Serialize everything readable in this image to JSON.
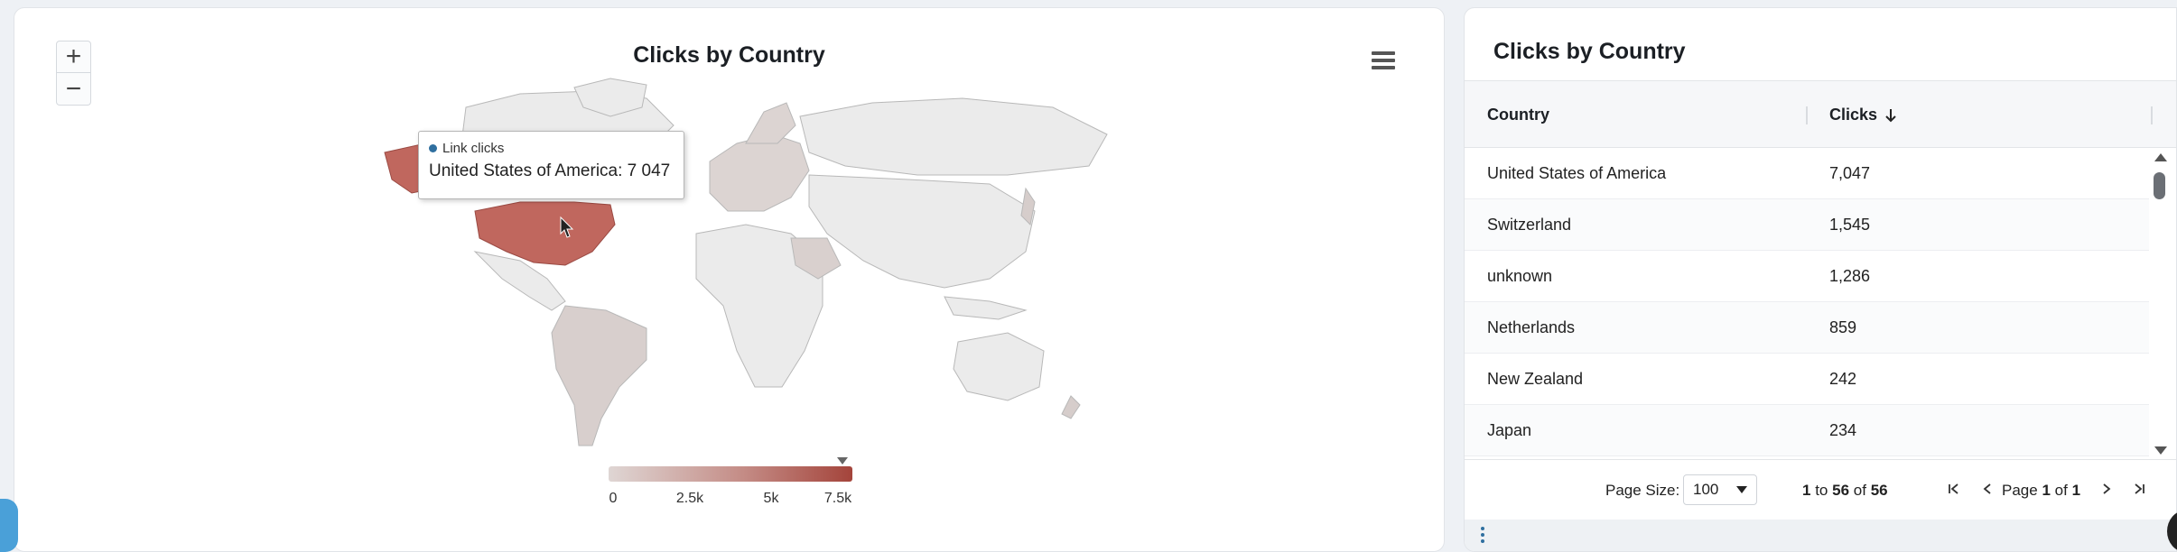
{
  "map_panel": {
    "title": "Clicks by Country",
    "zoom_in_label": "+",
    "zoom_out_label": "−",
    "menu_icon": "hamburger-menu-icon",
    "tooltip": {
      "series_name": "Link clicks",
      "text": "United States of America: 7 047"
    },
    "legend": {
      "ticks": [
        "0",
        "2.5k",
        "5k",
        "7.5k"
      ],
      "colors": [
        "#dfd6d4",
        "#a4443b"
      ]
    },
    "highlight_color": "#c0675e"
  },
  "table_panel": {
    "title": "Clicks by Country",
    "columns": [
      "Country",
      "Clicks"
    ],
    "sort_icon": "arrow-down-icon",
    "rows": [
      {
        "country": "United States of America",
        "clicks": "7,047"
      },
      {
        "country": "Switzerland",
        "clicks": "1,545"
      },
      {
        "country": "unknown",
        "clicks": "1,286"
      },
      {
        "country": "Netherlands",
        "clicks": "859"
      },
      {
        "country": "New Zealand",
        "clicks": "242"
      },
      {
        "country": "Japan",
        "clicks": "234"
      }
    ],
    "footer": {
      "page_size_label": "Page Size:",
      "page_size_value": "100",
      "range_from": "1",
      "range_to_word": "to",
      "range_to": "56",
      "range_of_word": "of",
      "range_total": "56",
      "page_word": "Page",
      "page_current": "1",
      "page_of_word": "of",
      "page_total": "1"
    }
  }
}
